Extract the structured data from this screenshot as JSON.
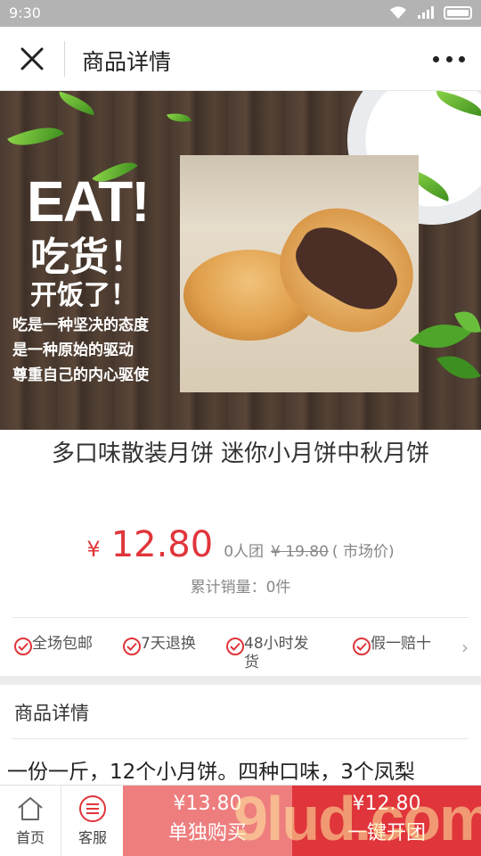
{
  "status_bar": {
    "time": "9:30"
  },
  "nav": {
    "title": "商品详情"
  },
  "banner": {
    "headline": "EAT!",
    "line1": "吃货！",
    "line2": "开饭了！",
    "slogans": [
      "吃是一种坚决的态度",
      "是一种原始的驱动",
      "尊重自己的内心驱使"
    ]
  },
  "product": {
    "name": "多口味散装月饼 迷你小月饼中秋月饼",
    "currency_symbol": "¥",
    "price": "12.80",
    "group_count": "0人团",
    "original_price": "¥ 19.80",
    "market_label": "( 市场价)",
    "sales_label": "累计销量：",
    "sales_value": "0件"
  },
  "guarantees": [
    {
      "label": "全场包邮"
    },
    {
      "label": "7天退换"
    },
    {
      "label": "48小时发货"
    },
    {
      "label": "假一赔十"
    }
  ],
  "detail": {
    "title": "商品详情",
    "text": "一份一斤，12个小月饼。四种口味，3个凤梨"
  },
  "bottom_bar": {
    "home_label": "首页",
    "service_label": "客服",
    "single_price": "¥13.80",
    "single_label": "单独购买",
    "group_price": "¥12.80",
    "group_label": "一键开团"
  },
  "watermark": "9lud.com",
  "colors": {
    "accent": "#e0353b",
    "single_button": "#ee7e7e"
  }
}
